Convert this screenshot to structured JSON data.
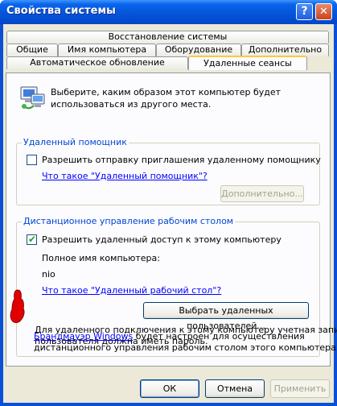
{
  "window": {
    "title": "Свойства системы"
  },
  "tabs": {
    "row1": [
      "Восстановление системы"
    ],
    "row2": [
      "Общие",
      "Имя компьютера",
      "Оборудование",
      "Дополнительно"
    ],
    "row3": [
      "Автоматическое обновление",
      "Удаленные сеансы"
    ],
    "active": "Удаленные сеансы"
  },
  "intro_text": [
    "Выберите, каким образом этот компьютер будет",
    "использоваться из другого места."
  ],
  "remote_assistance": {
    "title": "Удаленный помощник",
    "checkbox_label": "Разрешить отправку приглашения удаленному помощнику",
    "checked": false,
    "help_link": "Что такое \"Удаленный помощник\"?",
    "advanced_button": "Дополнительно..."
  },
  "remote_desktop": {
    "title": "Дистанционное управление рабочим столом",
    "checkbox_label": "Разрешить удаленный доступ к этому компьютеру",
    "checked": true,
    "computer_name_label": "Полное имя компьютера:",
    "computer_name": "nio",
    "help_link": "Что такое \"Удаленный рабочий стол\"?",
    "select_users_button": "Выбрать удаленных пользователей...",
    "password_note": [
      "Для удаленного подключения к этому компьютеру учетная запись",
      "пользователя должна иметь пароль."
    ],
    "firewall_link": "Брандмауэр Windows",
    "firewall_text_rest": " будет настроен для осуществления",
    "firewall_text_line2": "дистанционного управления рабочим столом этого компьютера."
  },
  "buttons": {
    "ok": "ОК",
    "cancel": "Отмена",
    "apply": "Применить"
  },
  "colors": {
    "titlebar": "#0453d8",
    "dialog_bg": "#ece9d8",
    "group_title": "#0046d5",
    "link": "#0000ff",
    "annotation_marker": "#e00000"
  },
  "icons": {
    "intro": "computer-network-icon",
    "annotation": "red-hand-pointer-icon"
  }
}
